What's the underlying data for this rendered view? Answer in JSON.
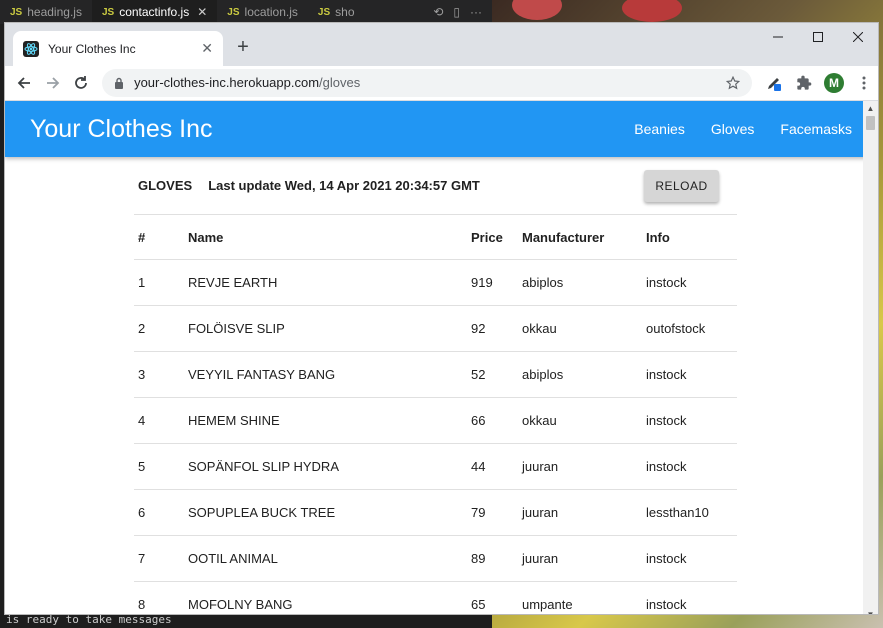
{
  "editor": {
    "tabs": [
      {
        "label": "heading.js",
        "active": false,
        "close": ""
      },
      {
        "label": "contactinfo.js",
        "active": true,
        "close": "✕"
      },
      {
        "label": "location.js",
        "active": false,
        "close": ""
      },
      {
        "label": "sho",
        "active": false,
        "close": ""
      }
    ],
    "file_badge": "JS",
    "overflow_label": "···"
  },
  "terminal": {
    "line": "is ready to take messages"
  },
  "browser": {
    "tab_title": "Your Clothes Inc",
    "tab_close": "✕",
    "new_tab_label": "+",
    "url_host": "your-clothes-inc.herokuapp.com",
    "url_path": "/gloves",
    "profile_initial": "M"
  },
  "app": {
    "title": "Your Clothes Inc",
    "nav": [
      "Beanies",
      "Gloves",
      "Facemasks"
    ],
    "category": "GLOVES",
    "last_update": "Last update Wed, 14 Apr 2021 20:34:57 GMT",
    "reload_label": "RELOAD",
    "table": {
      "headers": [
        "#",
        "Name",
        "Price",
        "Manufacturer",
        "Info"
      ],
      "rows": [
        [
          "1",
          "REVJE EARTH",
          "919",
          "abiplos",
          "instock"
        ],
        [
          "2",
          "FOLÖISVE SLIP",
          "92",
          "okkau",
          "outofstock"
        ],
        [
          "3",
          "VEYYIL FANTASY BANG",
          "52",
          "abiplos",
          "instock"
        ],
        [
          "4",
          "HEMEM SHINE",
          "66",
          "okkau",
          "instock"
        ],
        [
          "5",
          "SOPÄNFOL SLIP HYDRA",
          "44",
          "juuran",
          "instock"
        ],
        [
          "6",
          "SOPUPLEA BUCK TREE",
          "79",
          "juuran",
          "lessthan10"
        ],
        [
          "7",
          "OOTIL ANIMAL",
          "89",
          "juuran",
          "instock"
        ],
        [
          "8",
          "MOFOLNY BANG",
          "65",
          "umpante",
          "instock"
        ]
      ]
    }
  },
  "colors": {
    "app_bar": "#2196f3",
    "reload_bg": "#d6d6d6"
  }
}
